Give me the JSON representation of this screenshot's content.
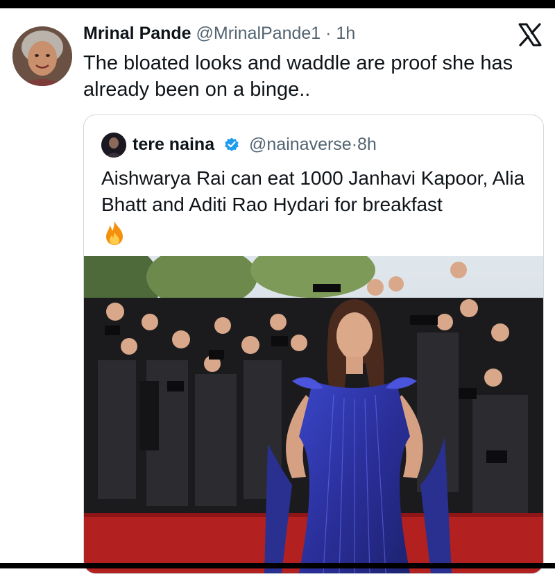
{
  "tweet": {
    "author_name": "Mrinal Pande",
    "handle": "@MrinalPande1",
    "separator": "·",
    "time": "1h",
    "text": "The bloated looks and waddle are proof she has already been on a binge.."
  },
  "quoted_tweet": {
    "author_name": "tere naina",
    "handle": "@nainaverse",
    "separator": "·",
    "time": "8h",
    "text": "Aishwarya Rai can eat 1000 Janhavi Kapoor, Alia Bhatt and Aditi Rao Hydari for breakfast",
    "emoji_icon": "fire-emoji-icon",
    "verified_color": "#1d9bf0"
  },
  "icons": {
    "platform": "x-logo-icon"
  }
}
